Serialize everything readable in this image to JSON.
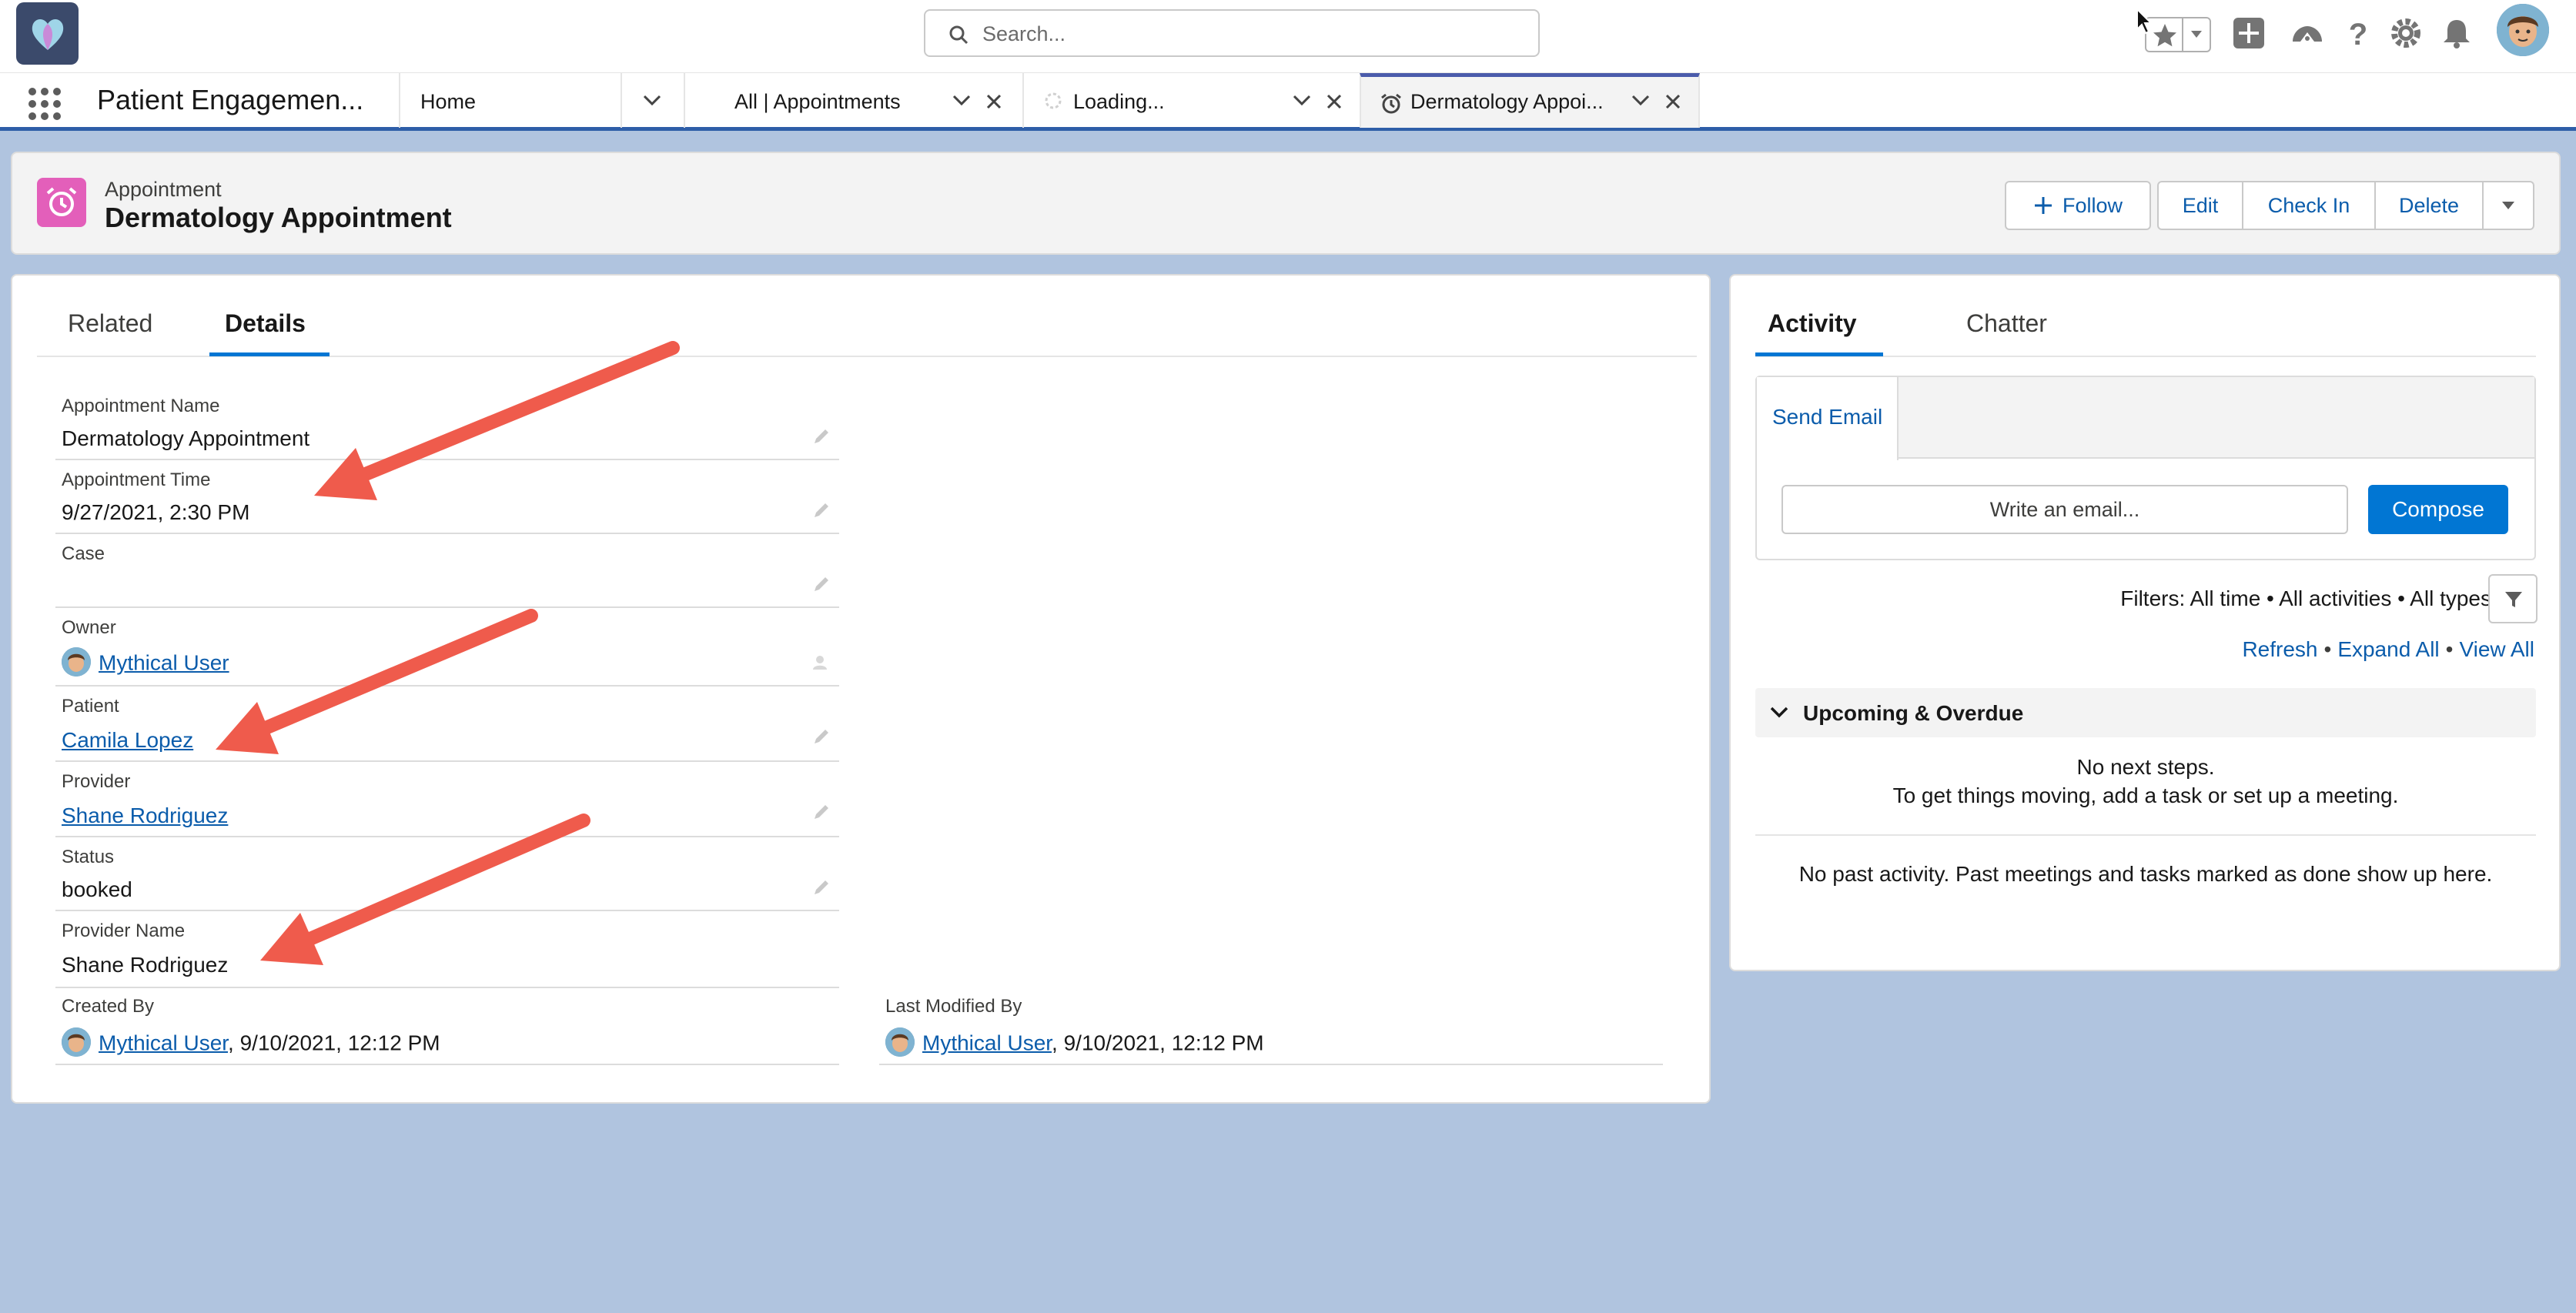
{
  "global_header": {
    "search_placeholder": "Search...",
    "icons": [
      "app-logo",
      "search-icon",
      "star-icon",
      "chevron-down-icon",
      "add-icon",
      "trailhead-icon",
      "help-icon",
      "setup-gear-icon",
      "notification-bell-icon",
      "avatar"
    ]
  },
  "nav": {
    "app_name": "Patient Engagemen...",
    "tabs": [
      {
        "label": "Home"
      },
      {
        "label": "All | Appointments"
      },
      {
        "label": "Loading..."
      },
      {
        "label": "Dermatology Appoi..."
      }
    ]
  },
  "record": {
    "type": "Appointment",
    "title": "Dermatology Appointment",
    "icon_color": "#e35fba",
    "actions": {
      "follow": "Follow",
      "edit": "Edit",
      "check_in": "Check In",
      "delete": "Delete"
    }
  },
  "details": {
    "tabs": {
      "related": "Related",
      "details": "Details"
    },
    "fields": {
      "appointment_name": {
        "label": "Appointment Name",
        "value": "Dermatology Appointment"
      },
      "appointment_time": {
        "label": "Appointment Time",
        "value": "9/27/2021, 2:30 PM"
      },
      "case": {
        "label": "Case",
        "value": ""
      },
      "owner": {
        "label": "Owner",
        "value": "Mythical User"
      },
      "patient": {
        "label": "Patient",
        "value": "Camila Lopez"
      },
      "provider": {
        "label": "Provider",
        "value": "Shane Rodriguez"
      },
      "status": {
        "label": "Status",
        "value": "booked"
      },
      "provider_name": {
        "label": "Provider Name",
        "value": "Shane Rodriguez"
      },
      "created_by": {
        "label": "Created By",
        "user": "Mythical User",
        "date": ", 9/10/2021, 12:12 PM"
      },
      "last_modified_by": {
        "label": "Last Modified By",
        "user": "Mythical User",
        "date": ", 9/10/2021, 12:12 PM"
      }
    }
  },
  "activity": {
    "tabs": {
      "activity": "Activity",
      "chatter": "Chatter"
    },
    "send_email_tab": "Send Email",
    "email_placeholder": "Write an email...",
    "compose": "Compose",
    "filters": "Filters: All time • All activities • All types",
    "links": {
      "refresh": "Refresh",
      "expand_all": "Expand All",
      "view_all": "View All"
    },
    "upcoming": "Upcoming & Overdue",
    "no_next_line1": "No next steps.",
    "no_next_line2": "To get things moving, add a task or set up a meeting.",
    "no_past": "No past activity. Past meetings and tasks marked as done show up here."
  },
  "colors": {
    "brand_blue": "#0176d3",
    "link_blue": "#0b5cab",
    "annotation_arrow": "#ef5b4c",
    "background": "#b0c4df"
  }
}
